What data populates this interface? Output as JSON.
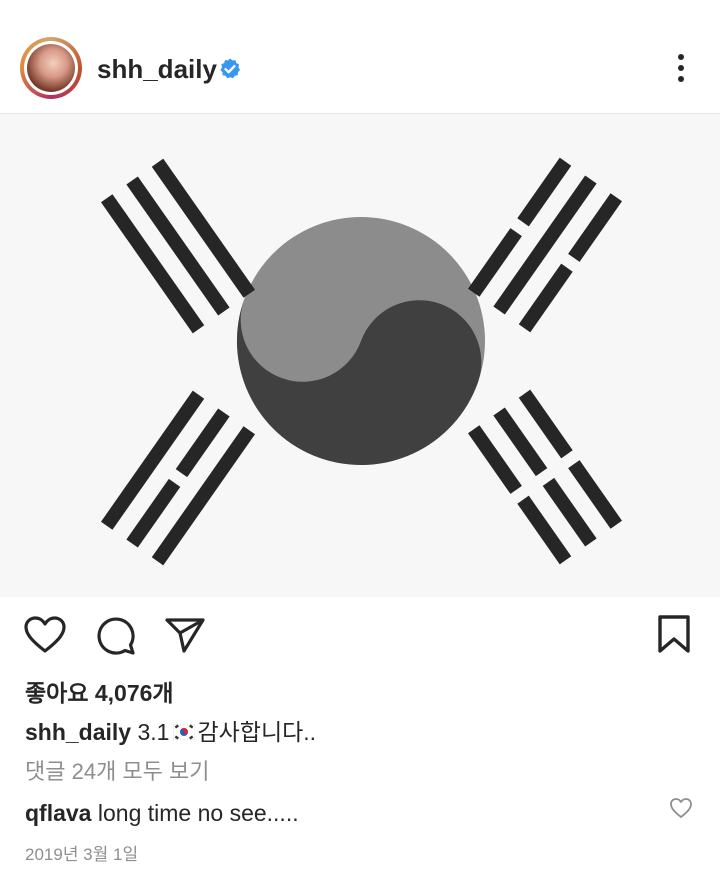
{
  "post": {
    "username": "shh_daily",
    "verified_icon": "verified-badge-icon",
    "more_icon": "more-vertical-icon",
    "accent_color": "#3897f0"
  },
  "image": {
    "description_icon": "taegukgi-flag"
  },
  "actions": {
    "like_icon": "heart-icon",
    "comment_icon": "comment-icon",
    "share_icon": "send-icon",
    "save_icon": "bookmark-icon"
  },
  "likes": {
    "label": "좋아요 4,076개"
  },
  "caption": {
    "username": "shh_daily",
    "text_before": "3.1",
    "emoji": "flag-south-korea",
    "text_after": "감사합니다.."
  },
  "comments": {
    "view_all": "댓글 24개 모두 보기",
    "items": [
      {
        "username": "qflava",
        "text": "long time no see....."
      }
    ]
  },
  "date": "2019년 3월 1일"
}
